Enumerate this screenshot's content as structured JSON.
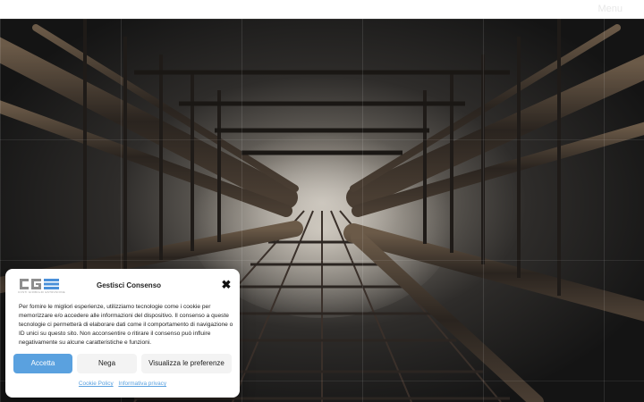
{
  "topbar": {
    "menu_label": "Menu"
  },
  "consent": {
    "logo_text": "CGE",
    "logo_tagline": "COSTI GIRIBALDI ESTRUSIONE",
    "title": "Gestisci Consenso",
    "close_symbol": "✖",
    "body": "Per fornire le migliori esperienze, utilizziamo tecnologie come i cookie per memorizzare e/o accedere alle informazioni del dispositivo. Il consenso a queste tecnologie ci permetterà di elaborare dati come il comportamento di navigazione o ID unici su questo sito. Non acconsentire o ritirare il consenso può influire negativamente su alcune caratteristiche e funzioni.",
    "buttons": {
      "accept": "Accetta",
      "deny": "Nega",
      "preferences": "Visualizza le preferenze"
    },
    "links": {
      "cookie_policy": "Cookie Policy",
      "privacy": "Informativa privacy"
    }
  },
  "colors": {
    "accent": "#5aa1df",
    "logo_gray": "#8e8e8e",
    "logo_blue": "#4a90d9"
  }
}
